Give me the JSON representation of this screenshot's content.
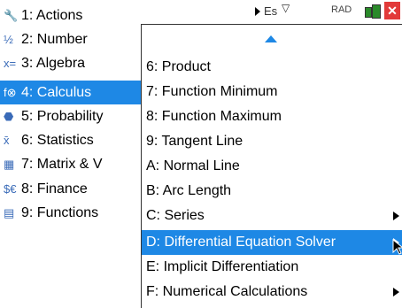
{
  "status_bar": {
    "doc_tab": "Es",
    "angle_mode": "RAD",
    "close_label": "✕",
    "accent": "#1e88e5",
    "close_color": "#e23a3a"
  },
  "main_menu": {
    "items": [
      {
        "icon": "tools-icon",
        "glyph": "🔧",
        "label": "1: Actions"
      },
      {
        "icon": "fraction-icon",
        "glyph": "½",
        "label": "2: Number"
      },
      {
        "icon": "x-equals-icon",
        "glyph": "x=",
        "label": "3: Algebra"
      },
      {
        "icon": "function-icon",
        "glyph": "f⊗",
        "label": "4: Calculus",
        "selected": true
      },
      {
        "icon": "dice-icon",
        "glyph": "⬣",
        "label": "5: Probability"
      },
      {
        "icon": "x-bar-icon",
        "glyph": "x̄",
        "label": "6: Statistics"
      },
      {
        "icon": "matrix-icon",
        "glyph": "▦",
        "label": "7: Matrix & V"
      },
      {
        "icon": "currency-icon",
        "glyph": "$€",
        "label": "8: Finance"
      },
      {
        "icon": "functions-icon",
        "glyph": "▤",
        "label": "9: Functions"
      }
    ]
  },
  "submenu": {
    "items": [
      {
        "label": "6: Product"
      },
      {
        "label": "7: Function Minimum"
      },
      {
        "label": "8: Function Maximum"
      },
      {
        "label": "9: Tangent Line"
      },
      {
        "label": "A: Normal Line"
      },
      {
        "label": "B: Arc Length"
      },
      {
        "label": "C: Series",
        "has_submenu": true
      },
      {
        "label": "D: Differential Equation Solver",
        "has_submenu": true,
        "selected": true
      },
      {
        "label": "E: Implicit Differentiation"
      },
      {
        "label": "F: Numerical Calculations",
        "has_submenu": true
      }
    ]
  }
}
